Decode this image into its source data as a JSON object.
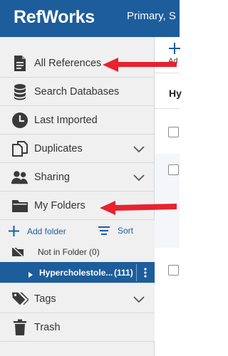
{
  "header": {
    "logo": "RefWorks",
    "account": "Primary, S"
  },
  "sidebar": {
    "items": [
      {
        "label": "All References",
        "icon": "document-icon"
      },
      {
        "label": "Search Databases",
        "icon": "database-icon"
      },
      {
        "label": "Last Imported",
        "icon": "clock-icon"
      },
      {
        "label": "Duplicates",
        "icon": "duplicates-icon",
        "expandable": true
      },
      {
        "label": "Sharing",
        "icon": "people-icon",
        "expandable": true
      },
      {
        "label": "My Folders",
        "icon": "folder-icon"
      }
    ],
    "folder_toolbar": {
      "add_label": "Add folder",
      "sort_label": "Sort"
    },
    "folders": [
      {
        "label": "Not in Folder (0)"
      },
      {
        "label": "Hypercholestole...",
        "count": "(111)",
        "selected": true
      }
    ],
    "bottom_items": [
      {
        "label": "Tags",
        "icon": "tag-icon",
        "expandable": true
      },
      {
        "label": "Trash",
        "icon": "trash-icon"
      }
    ]
  },
  "main": {
    "add_caption": "Ad",
    "heading": "Hy"
  },
  "colors": {
    "header": "#1d5d9b",
    "sidebar": "#f0f0f0",
    "selected": "#1d5d9b",
    "annotation_arrow": "#e8222e"
  }
}
